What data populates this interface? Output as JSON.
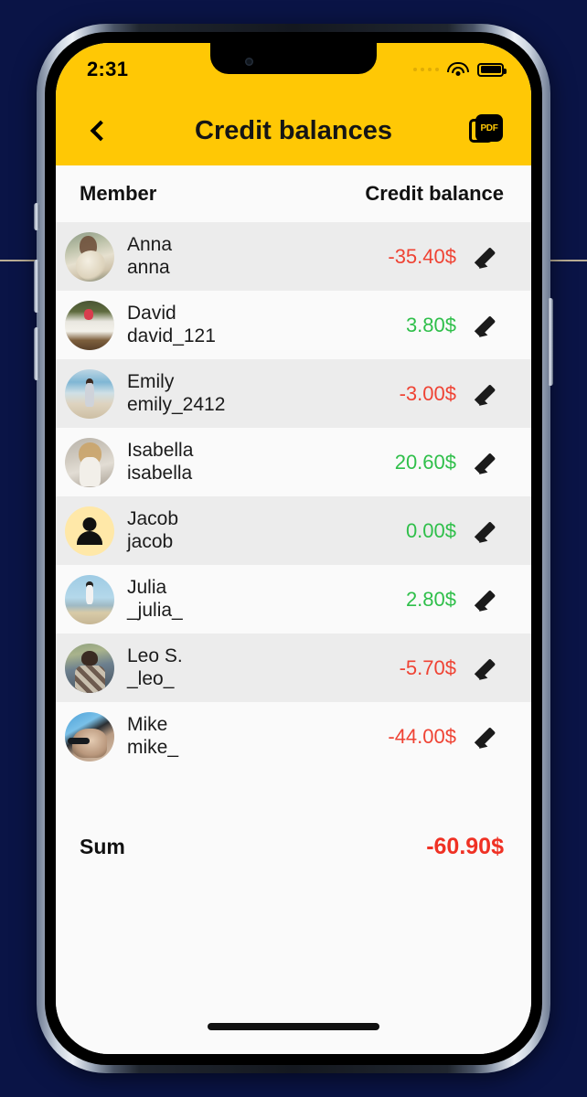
{
  "status_bar": {
    "time": "2:31",
    "signal_icon": "signal-dots-icon",
    "wifi_icon": "wifi-icon",
    "battery_icon": "battery-full-icon"
  },
  "nav": {
    "back_icon": "chevron-left-icon",
    "title": "Credit balances",
    "pdf_label": "PDF",
    "pdf_icon": "pdf-export-icon"
  },
  "table": {
    "header": {
      "member": "Member",
      "balance": "Credit balance"
    },
    "edit_icon": "pencil-icon",
    "rows": [
      {
        "name": "Anna",
        "handle": "anna",
        "amount": "-35.40$",
        "sign": "neg",
        "avatar": "av-anna",
        "avatar_name": "avatar-anna"
      },
      {
        "name": "David",
        "handle": "david_121",
        "amount": "3.80$",
        "sign": "pos",
        "avatar": "av-david",
        "avatar_name": "avatar-david"
      },
      {
        "name": "Emily",
        "handle": "emily_2412",
        "amount": "-3.00$",
        "sign": "neg",
        "avatar": "av-emily",
        "avatar_name": "avatar-emily"
      },
      {
        "name": "Isabella",
        "handle": "isabella",
        "amount": "20.60$",
        "sign": "pos",
        "avatar": "av-isabella",
        "avatar_name": "avatar-isabella"
      },
      {
        "name": "Jacob",
        "handle": "jacob",
        "amount": "0.00$",
        "sign": "pos",
        "avatar": "av-jacob",
        "avatar_name": "avatar-jacob-placeholder"
      },
      {
        "name": "Julia",
        "handle": "_julia_",
        "amount": "2.80$",
        "sign": "pos",
        "avatar": "av-julia",
        "avatar_name": "avatar-julia"
      },
      {
        "name": "Leo S.",
        "handle": "_leo_",
        "amount": "-5.70$",
        "sign": "neg",
        "avatar": "av-leo",
        "avatar_name": "avatar-leo"
      },
      {
        "name": "Mike",
        "handle": "mike_",
        "amount": "-44.00$",
        "sign": "neg",
        "avatar": "av-mike",
        "avatar_name": "avatar-mike"
      }
    ]
  },
  "summary": {
    "label": "Sum",
    "value": "-60.90$"
  },
  "colors": {
    "brand_yellow": "#FFC805",
    "negative": "#EF4334",
    "positive": "#2FBF4A",
    "sum_negative": "#EF3124",
    "row_alt": "#ECECEC",
    "row_plain": "#FAFAFA",
    "backdrop": "#0A1446"
  }
}
